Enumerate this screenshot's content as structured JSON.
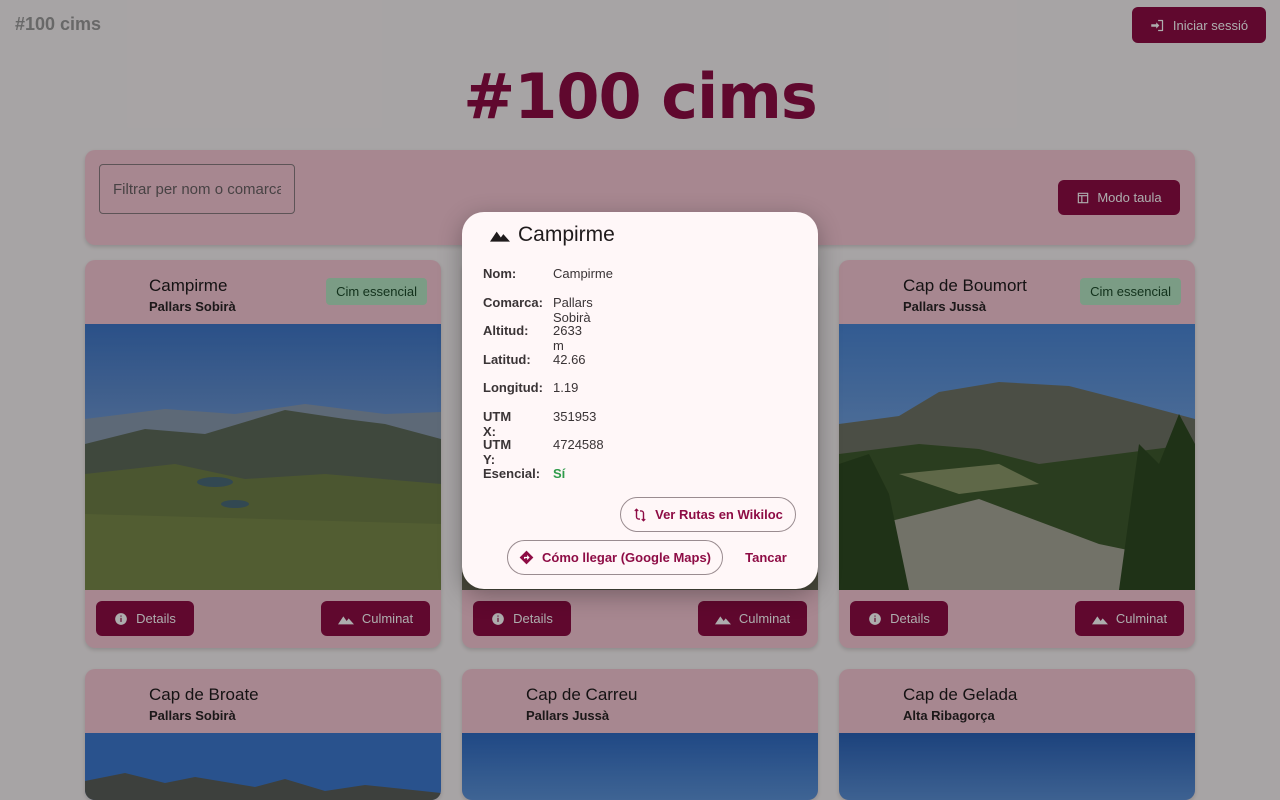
{
  "header": {
    "brand": "#100 cims",
    "login_label": "Iniciar sessió",
    "hero_title": "#100 cims"
  },
  "filter": {
    "placeholder": "Filtrar per nom o comarca",
    "table_mode_label": "Modo taula"
  },
  "card_buttons": {
    "details_label": "Details",
    "climbed_label": "Culminat"
  },
  "cards": [
    {
      "name": "Campirme",
      "region": "Pallars Sobirà",
      "badge": "Cim essencial"
    },
    {
      "name": "",
      "region": "",
      "badge": ""
    },
    {
      "name": "Cap de Boumort",
      "region": "Pallars Jussà",
      "badge": "Cim essencial"
    },
    {
      "name": "Cap de Broate",
      "region": "Pallars Sobirà",
      "badge": ""
    },
    {
      "name": "Cap de Carreu",
      "region": "Pallars Jussà",
      "badge": ""
    },
    {
      "name": "Cap de Gelada",
      "region": "Alta Ribagorça",
      "badge": ""
    }
  ],
  "dialog": {
    "title": "Campirme",
    "rows": [
      {
        "label": "Nom:",
        "value": "Campirme"
      },
      {
        "label": "Comarca:",
        "value": "Pallars Sobirà"
      },
      {
        "label": "Altitud:",
        "value": "2633 m"
      },
      {
        "label": "Latitud:",
        "value": "42.66"
      },
      {
        "label": "Longitud:",
        "value": "1.19"
      },
      {
        "label": "UTM X:",
        "value": "351953"
      },
      {
        "label": "UTM Y:",
        "value": "4724588"
      },
      {
        "label": "Esencial:",
        "value": "Sí"
      }
    ],
    "wikiloc_label": "Ver Rutas en Wikiloc",
    "maps_label": "Cómo llegar (Google Maps)",
    "close_label": "Tancar"
  },
  "colors": {
    "primary": "#8e0c45",
    "card_bg": "#f6c8d5",
    "badge_bg": "#b5e6c4",
    "essential_green": "#2e9b4a"
  },
  "icons": {
    "login": "login-icon",
    "table": "table-icon",
    "info": "info-icon",
    "mountain": "mountain-icon",
    "route": "route-icon",
    "directions": "directions-icon"
  }
}
